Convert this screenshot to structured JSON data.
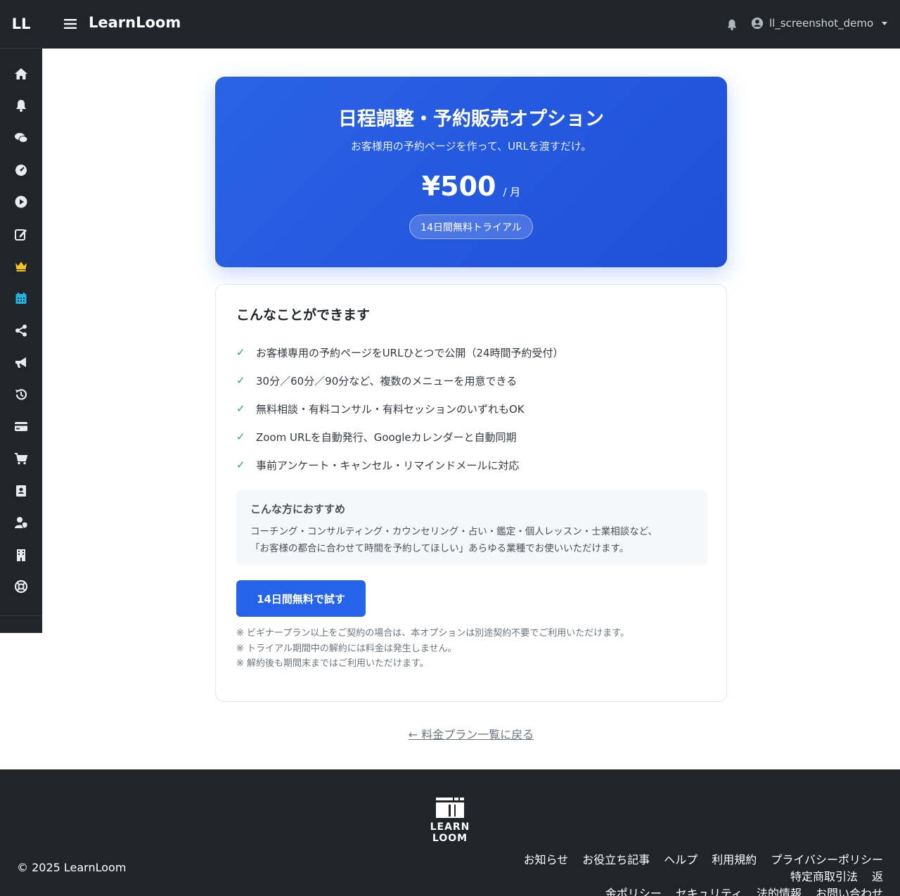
{
  "sidebar": {
    "brand": "LL",
    "items": [
      {
        "icon": "home-icon",
        "active": false
      },
      {
        "icon": "bell-icon",
        "active": false
      },
      {
        "icon": "chat-icon",
        "active": false
      },
      {
        "icon": "dashboard-icon",
        "active": false
      },
      {
        "icon": "play-icon",
        "active": false
      },
      {
        "icon": "edit-icon",
        "active": false
      },
      {
        "icon": "crown-icon",
        "active": false,
        "color": "#f5c518"
      },
      {
        "icon": "calendar-icon",
        "active": true,
        "color": "#1fb6e8"
      },
      {
        "icon": "share-icon",
        "active": false
      },
      {
        "icon": "megaphone-icon",
        "active": false
      },
      {
        "icon": "history-icon",
        "active": false
      },
      {
        "icon": "credit-card-icon",
        "active": false
      },
      {
        "icon": "cart-icon",
        "active": false
      },
      {
        "icon": "contact-book-icon",
        "active": false
      },
      {
        "icon": "user-shield-icon",
        "active": false
      },
      {
        "icon": "building-icon",
        "active": false
      },
      {
        "icon": "lifebuoy-icon",
        "active": false
      }
    ]
  },
  "header": {
    "title": "LearnLoom",
    "username": "ll_screenshot_demo"
  },
  "hero": {
    "title": "日程調整・予約販売オプション",
    "subtitle": "お客様用の予約ページを作って、URLを渡すだけ。",
    "price": "¥500",
    "per": "/ 月",
    "trial_badge": "14日間無料トライアル",
    "color": "#2563eb"
  },
  "features": {
    "title": "こんなことができます",
    "items": [
      "お客様専用の予約ページをURLひとつで公開（24時間予約受付）",
      "30分／60分／90分など、複数のメニューを用意できる",
      "無料相談・有料コンサル・有料セッションのいずれもOK",
      "Zoom URLを自動発行、Googleカレンダーと自動同期",
      "事前アンケート・キャンセル・リマインドメールに対応"
    ],
    "check_symbol": "✓",
    "recommend_title": "こんな方におすすめ",
    "recommend_line1": "コーチング・コンサルティング・カウンセリング・占い・鑑定・個人レッスン・士業相談など、",
    "recommend_line2": "「お客様の都合に合わせて時間を予約してほしい」あらゆる業種でお使いいただけます。",
    "cta_label": "14日間無料で試す",
    "notes": [
      "※ ビギナープラン以上をご契約の場合は、本オプションは別途契約不要でご利用いただけます。",
      "※ トライアル期間中の解約には料金は発生しません。",
      "※ 解約後も期間末まではご利用いただけます。"
    ]
  },
  "back_link": "← 料金プラン一覧に戻る",
  "footer": {
    "logo_text": "LEARN LOOM",
    "copyright": "© 2025 LearnLoom",
    "links_row1": [
      "お知らせ",
      "お役立ち記事",
      "ヘルプ",
      "利用規約",
      "プライバシーポリシー",
      "特定商取引法",
      "返"
    ],
    "links_row2": [
      "金ポリシー",
      "セキュリティ",
      "法的情報",
      "お問い合わせ"
    ]
  }
}
